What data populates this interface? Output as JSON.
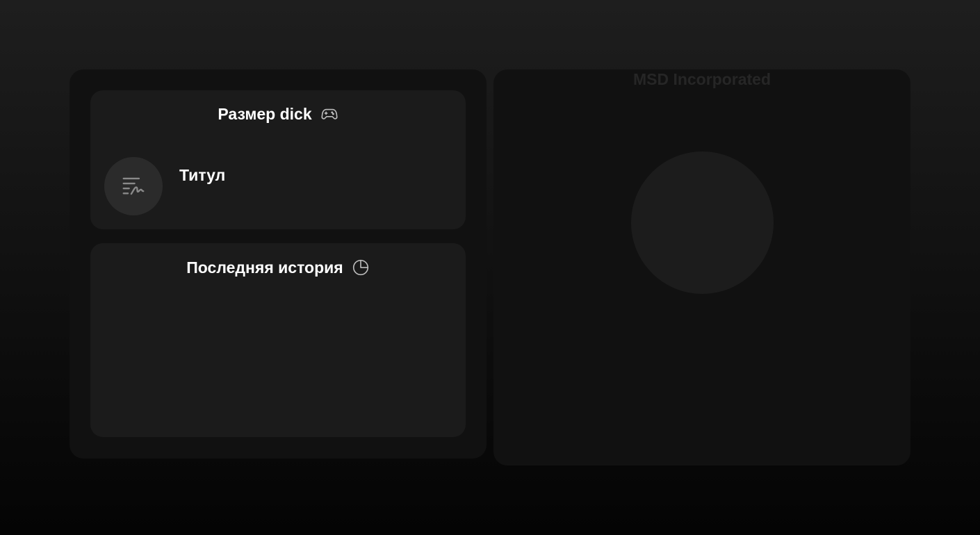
{
  "game_card": {
    "title": "Размер dick",
    "icon": "gamepad-icon",
    "rank_icon": "signature-icon",
    "rank_label": "Титул"
  },
  "history_card": {
    "title": "Последняя история",
    "icon": "pie-chart-icon"
  },
  "right_panel": {
    "title": "MSD Incorporated",
    "avatar": "profile-circle"
  },
  "colors": {
    "background_top": "#1e1e1e",
    "background_bottom": "#040404",
    "panel": "#111111",
    "card": "#1b1b1b",
    "avatar": "#2b2b2b",
    "muted_title": "#262626"
  }
}
